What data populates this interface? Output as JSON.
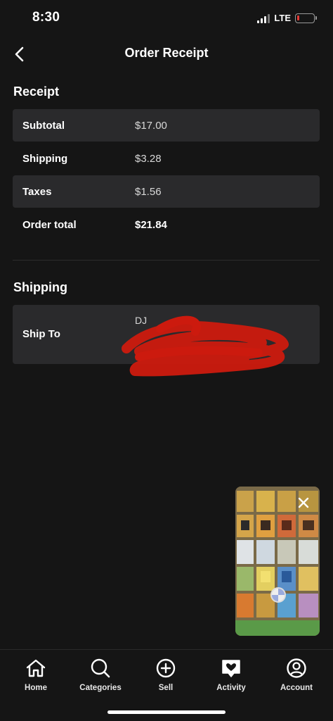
{
  "status_bar": {
    "time": "8:30",
    "network": "LTE"
  },
  "header": {
    "title": "Order Receipt"
  },
  "receipt": {
    "title": "Receipt",
    "rows": [
      {
        "label": "Subtotal",
        "value": "$17.00"
      },
      {
        "label": "Shipping",
        "value": "$3.28"
      },
      {
        "label": "Taxes",
        "value": "$1.56"
      },
      {
        "label": "Order total",
        "value": "$21.84"
      }
    ]
  },
  "shipping": {
    "title": "Shipping",
    "ship_to_label": "Ship To",
    "address_visible": "DJ"
  },
  "tabs": [
    {
      "label": "Home",
      "icon": "home-icon"
    },
    {
      "label": "Categories",
      "icon": "search-icon"
    },
    {
      "label": "Sell",
      "icon": "plus-circle-icon"
    },
    {
      "label": "Activity",
      "icon": "heart-bubble-icon"
    },
    {
      "label": "Account",
      "icon": "account-icon"
    }
  ],
  "colors": {
    "background": "#151515",
    "row_shade": "#2a2a2c",
    "redaction": "#cc1a0e"
  }
}
